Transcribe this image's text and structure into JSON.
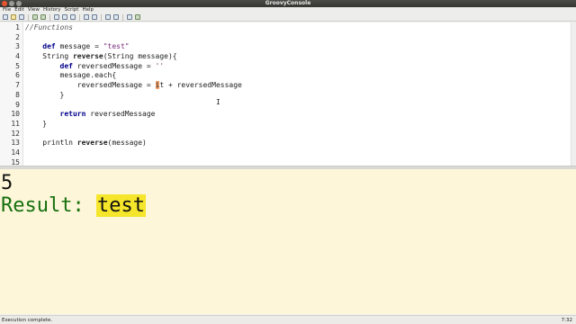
{
  "window": {
    "title": "GroovyConsole"
  },
  "menu": [
    "File",
    "Edit",
    "View",
    "History",
    "Script",
    "Help"
  ],
  "editor": {
    "lines": [
      {
        "n": "1",
        "html": "<span class='cm'>//Functions</span>"
      },
      {
        "n": "2",
        "html": ""
      },
      {
        "n": "3",
        "html": "    <span class='kw'>def</span> message = <span class='str'>\"test\"</span>"
      },
      {
        "n": "4",
        "html": "    String <span class='fn'>reverse</span>(String message){"
      },
      {
        "n": "5",
        "html": "        <span class='kw'>def</span> reversedMessage = <span class='str'>''</span>"
      },
      {
        "n": "6",
        "html": "        message.each{"
      },
      {
        "n": "7",
        "html": "            reversedMessage = <span class='caret-hl'>i</span>t + reversedMessage"
      },
      {
        "n": "8",
        "html": "        }"
      },
      {
        "n": "9",
        "html": ""
      },
      {
        "n": "10",
        "html": "        <span class='kw'>return</span> reversedMessage"
      },
      {
        "n": "11",
        "html": "    }"
      },
      {
        "n": "12",
        "html": ""
      },
      {
        "n": "13",
        "html": "    println <span class='fn'>reverse</span>(message)"
      },
      {
        "n": "14",
        "html": ""
      },
      {
        "n": "15",
        "html": ""
      }
    ]
  },
  "output": {
    "line1": "5",
    "result_label": "Result: ",
    "result_value": "test"
  },
  "status": {
    "message": "Execution complete.",
    "position": "7:32"
  }
}
